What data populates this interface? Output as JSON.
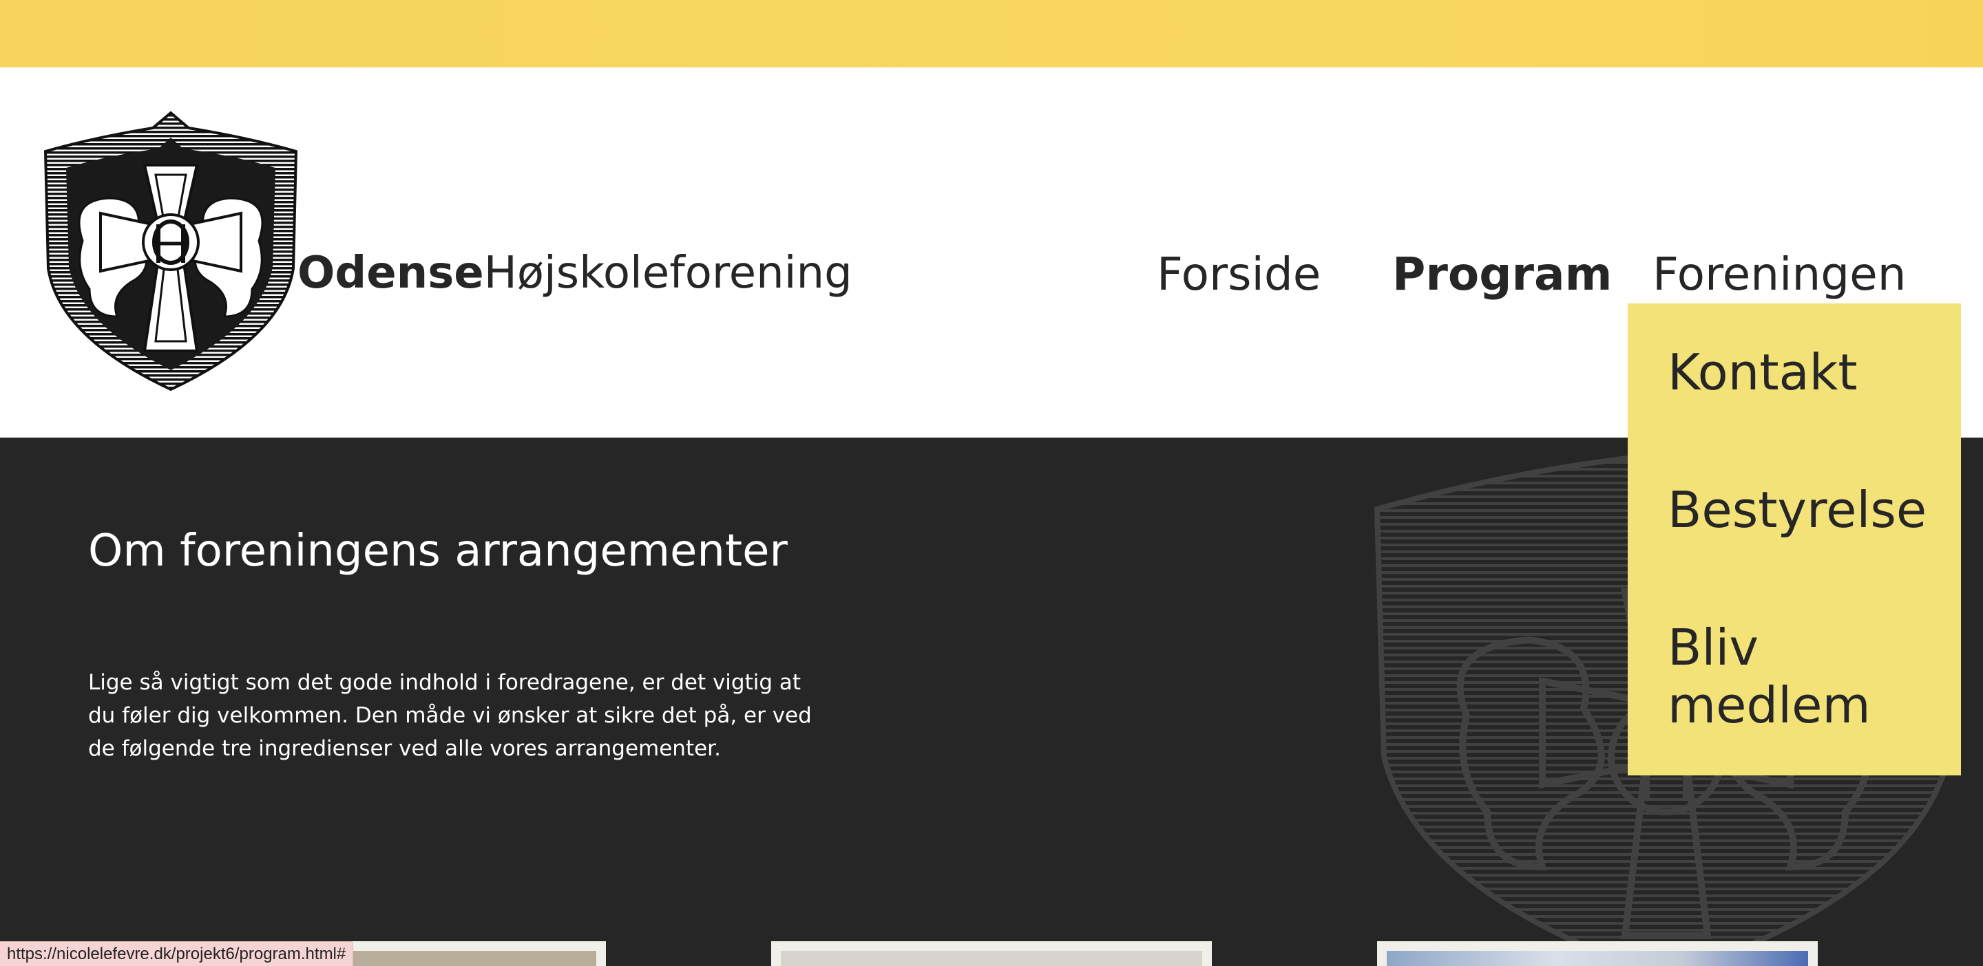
{
  "brand": {
    "bold": "Odense",
    "light": "Højskoleforening"
  },
  "nav": {
    "forside": "Forside",
    "program": "Program",
    "foreningen": "Foreningen"
  },
  "dropdown": {
    "kontakt": "Kontakt",
    "bestyrelse": "Bestyrelse",
    "bliv_medlem": "Bliv medlem"
  },
  "section": {
    "title": "Om foreningens arrangementer",
    "text": "Lige så vigtigt som det gode indhold i foredragene, er det vigtig at du føler dig velkommen. Den måde vi ønsker at sikre det på, er ved de følgende tre ingredienser ved alle vores arrangementer."
  },
  "status_bar": {
    "url": "https://nicolelefevre.dk/projekt6/program.html#"
  },
  "colors": {
    "top_bar": "#f7d55e",
    "dark_bg": "#262626",
    "dropdown_bg": "#f2e277",
    "text_dark": "#262626"
  }
}
